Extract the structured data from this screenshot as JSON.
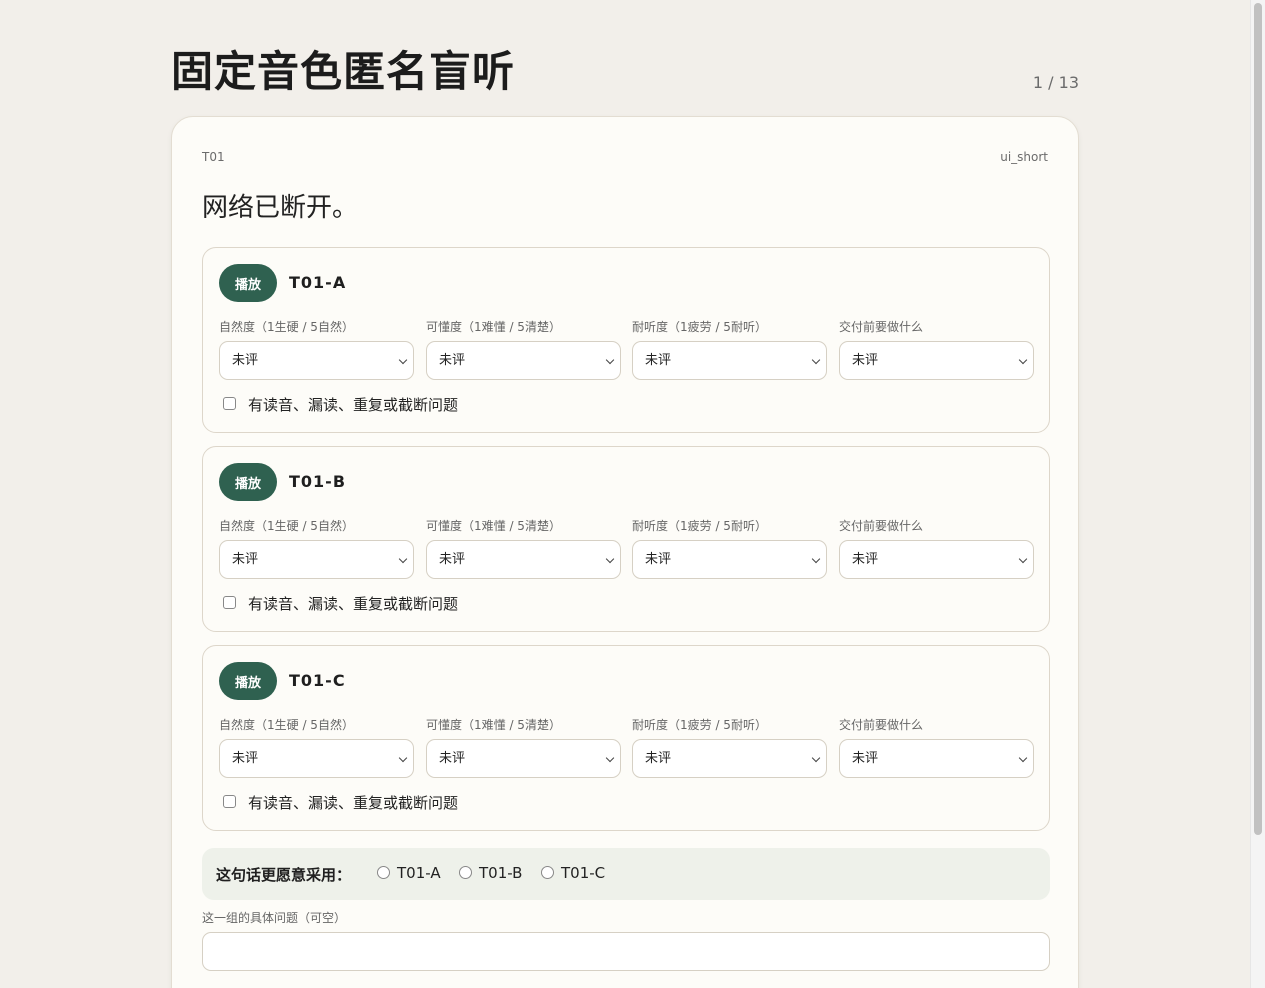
{
  "page": {
    "title": "固定音色匿名盲听",
    "counter": "1 / 13"
  },
  "card": {
    "id": "T01",
    "tag": "ui_short",
    "sentence": "网络已断开。",
    "variants": [
      {
        "play_label": "播放",
        "name": "T01-A",
        "fields": [
          {
            "label": "自然度（1生硬 / 5自然）",
            "value": "未评"
          },
          {
            "label": "可懂度（1难懂 / 5清楚）",
            "value": "未评"
          },
          {
            "label": "耐听度（1疲劳 / 5耐听）",
            "value": "未评"
          },
          {
            "label": "交付前要做什么",
            "value": "未评"
          }
        ],
        "issue_label": "有读音、漏读、重复或截断问题"
      },
      {
        "play_label": "播放",
        "name": "T01-B",
        "fields": [
          {
            "label": "自然度（1生硬 / 5自然）",
            "value": "未评"
          },
          {
            "label": "可懂度（1难懂 / 5清楚）",
            "value": "未评"
          },
          {
            "label": "耐听度（1疲劳 / 5耐听）",
            "value": "未评"
          },
          {
            "label": "交付前要做什么",
            "value": "未评"
          }
        ],
        "issue_label": "有读音、漏读、重复或截断问题"
      },
      {
        "play_label": "播放",
        "name": "T01-C",
        "fields": [
          {
            "label": "自然度（1生硬 / 5自然）",
            "value": "未评"
          },
          {
            "label": "可懂度（1难懂 / 5清楚）",
            "value": "未评"
          },
          {
            "label": "耐听度（1疲劳 / 5耐听）",
            "value": "未评"
          },
          {
            "label": "交付前要做什么",
            "value": "未评"
          }
        ],
        "issue_label": "有读音、漏读、重复或截断问题"
      }
    ],
    "preference": {
      "label": "这句话更愿意采用：",
      "options": [
        "T01-A",
        "T01-B",
        "T01-C"
      ]
    },
    "notes": {
      "label": "这一组的具体问题（可空）",
      "value": "",
      "placeholder": ""
    }
  },
  "colors": {
    "accent": "#2f6150",
    "background": "#f2efea",
    "card": "#fdfcf8",
    "preference_bg": "#eef1ea"
  }
}
